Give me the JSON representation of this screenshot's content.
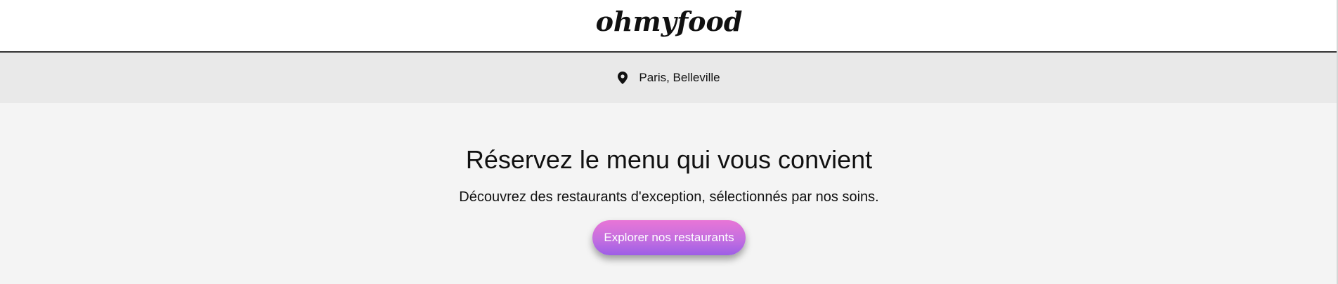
{
  "header": {
    "logo_text": "ohmyfood"
  },
  "location": {
    "icon": "map-pin-icon",
    "text": "Paris, Belleville"
  },
  "hero": {
    "title": "Réservez le menu qui vous convient",
    "subtitle": "Découvrez des restaurants d'exception, sélectionnés par nos soins.",
    "cta_label": "Explorer nos restaurants"
  },
  "colors": {
    "header_bg": "#ffffff",
    "location_bg": "#e9e9e9",
    "hero_bg": "#f4f4f4",
    "cta_gradient_start": "#e875d6",
    "cta_gradient_end": "#9d5ee6",
    "text": "#111111"
  }
}
